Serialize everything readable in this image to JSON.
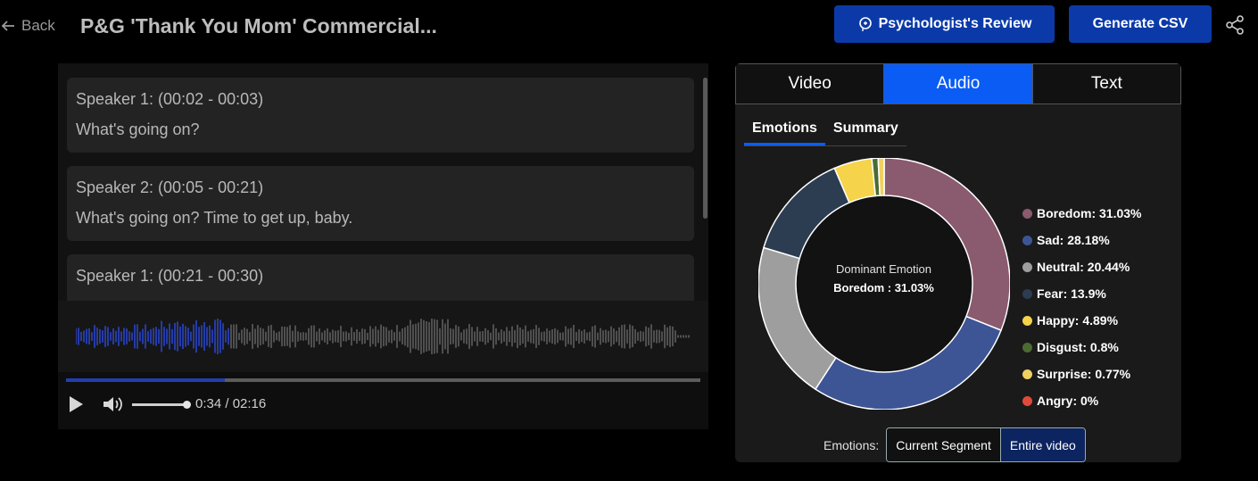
{
  "header": {
    "back_label": "Back",
    "title": "P&G 'Thank You Mom' Commercial...",
    "review_button": "Psychologist's Review",
    "csv_button": "Generate CSV",
    "accent": "#0b3aa8"
  },
  "transcript": {
    "segments": [
      {
        "speaker": "Speaker 1: (00:02 - 00:03)",
        "text": "What's going on?"
      },
      {
        "speaker": "Speaker 2: (00:05 - 00:21)",
        "text": "What's going on? Time to get up, baby."
      },
      {
        "speaker": "Speaker 1: (00:21 - 00:30)",
        "text": ""
      }
    ]
  },
  "player": {
    "time": "0:34 / 02:16",
    "progress": 0.25,
    "volume": 1.0
  },
  "analysis": {
    "tabs": [
      "Video",
      "Audio",
      "Text"
    ],
    "active_tab": "Audio",
    "sub_tabs": [
      "Emotions",
      "Summary"
    ],
    "active_sub_tab": "Emotions",
    "dominant_label": "Dominant Emotion",
    "dominant_value": "Boredom : 31.03%",
    "legend": [
      {
        "label": "Boredom: 31.03%",
        "color": "#8a5a6e"
      },
      {
        "label": "Sad: 28.18%",
        "color": "#3d5595"
      },
      {
        "label": "Neutral: 20.44%",
        "color": "#9e9e9e"
      },
      {
        "label": "Fear: 13.9%",
        "color": "#2c3d52"
      },
      {
        "label": "Happy: 4.89%",
        "color": "#f5d34a"
      },
      {
        "label": "Disgust: 0.8%",
        "color": "#4a6b32"
      },
      {
        "label": "Surprise: 0.77%",
        "color": "#f0d060"
      },
      {
        "label": "Angry: 0%",
        "color": "#e04a3a"
      }
    ],
    "footer_label": "Emotions:",
    "toggle": [
      "Current Segment",
      "Entire video"
    ],
    "active_toggle": "Entire video"
  },
  "chart_data": {
    "type": "pie",
    "categories": [
      "Boredom",
      "Sad",
      "Neutral",
      "Fear",
      "Happy",
      "Disgust",
      "Surprise",
      "Angry"
    ],
    "values": [
      31.03,
      28.18,
      20.44,
      13.9,
      4.89,
      0.8,
      0.77,
      0
    ]
  }
}
